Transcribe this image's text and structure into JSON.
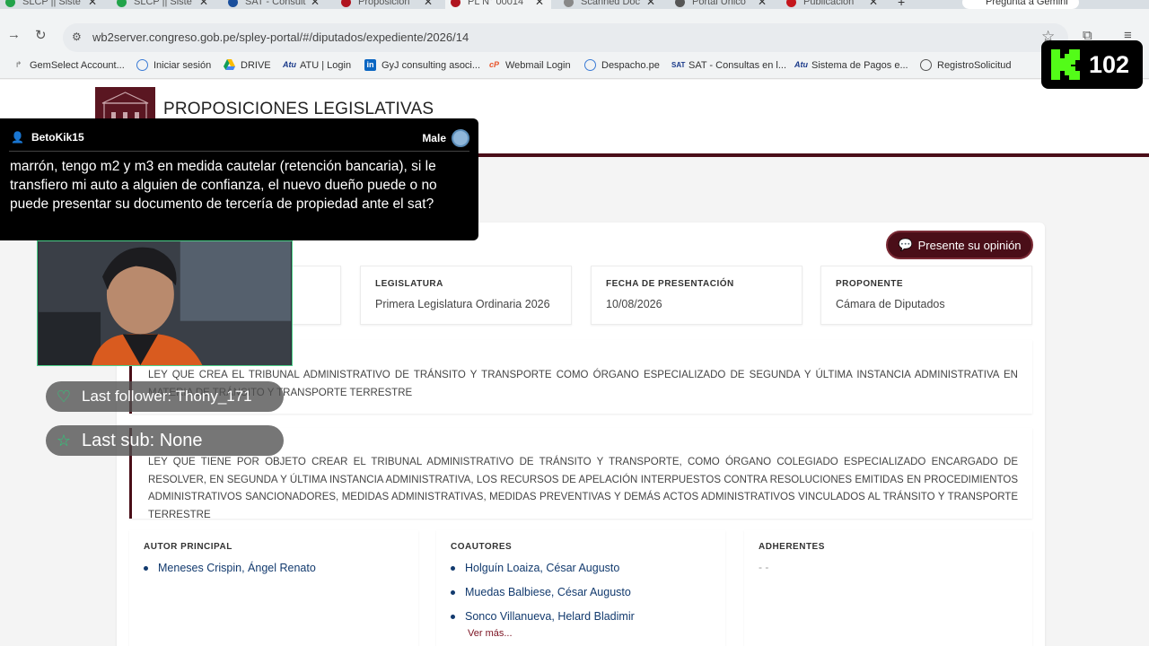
{
  "browser": {
    "tabs": [
      {
        "title": "SLCP || Siste",
        "color": "#22a34a"
      },
      {
        "title": "SLCP || Siste",
        "color": "#22a34a"
      },
      {
        "title": "SAT - Consult",
        "color": "#1a4f9c"
      },
      {
        "title": "Proposicion",
        "color": "#b0141f"
      },
      {
        "title": "PL N° 00014",
        "color": "#b0141f"
      },
      {
        "title": "Scanned Doc",
        "color": "#888888"
      },
      {
        "title": "Portal Único",
        "color": "#555555"
      },
      {
        "title": "Publicación",
        "color": "#c4161c"
      }
    ],
    "gemini_label": "Pregunta a Gemini",
    "url": "wb2server.congreso.gob.pe/spley-portal/#/diputados/expediente/2026/14",
    "bookmarks": [
      {
        "label": "GemSelect Account...",
        "icon": "gemselect-icon"
      },
      {
        "label": "Iniciar sesión",
        "icon": "globe-icon"
      },
      {
        "label": "DRIVE",
        "icon": "drive-icon"
      },
      {
        "label": "ATU | Login",
        "icon": "atu-icon"
      },
      {
        "label": "GyJ consulting asoci...",
        "icon": "linkedin-icon"
      },
      {
        "label": "Webmail Login",
        "icon": "webmail-icon"
      },
      {
        "label": "Despacho.pe",
        "icon": "globe-icon"
      },
      {
        "label": "SAT - Consultas en l...",
        "icon": "sat-icon"
      },
      {
        "label": "Sistema de Pagos e...",
        "icon": "atu-icon"
      },
      {
        "label": "RegistroSolicitud",
        "icon": "globe-icon"
      }
    ]
  },
  "page": {
    "title": "PROPOSICIONES LEGISLATIVAS",
    "opinion_button": "Presente su opinión",
    "meta": [
      {
        "label": "LEGISLATURA",
        "value": "Primera Legislatura Ordinaria 2026"
      },
      {
        "label": "FECHA DE PRESENTACIÓN",
        "value": "10/08/2026"
      },
      {
        "label": "PROPONENTE",
        "value": "Cámara de Diputados"
      }
    ],
    "titulo_text": "LEY QUE CREA EL TRIBUNAL ADMINISTRATIVO DE TRÁNSITO Y TRANSPORTE COMO ÓRGANO ESPECIALIZADO DE SEGUNDA Y ÚLTIMA INSTANCIA ADMINISTRATIVA EN MATERIA DE TRÁNSITO Y TRANSPORTE TERRESTRE",
    "sumilla_text": "LEY QUE TIENE POR OBJETO CREAR EL TRIBUNAL ADMINISTRATIVO DE TRÁNSITO Y TRANSPORTE, COMO ÓRGANO COLEGIADO ESPECIALIZADO ENCARGADO DE RESOLVER, EN SEGUNDA Y ÚLTIMA INSTANCIA ADMINISTRATIVA, LOS RECURSOS DE APELACIÓN INTERPUESTOS CONTRA RESOLUCIONES EMITIDAS EN PROCEDIMIENTOS ADMINISTRATIVOS SANCIONADORES, MEDIDAS ADMINISTRATIVAS, MEDIDAS PREVENTIVAS Y DEMÁS ACTOS ADMINISTRATIVOS VINCULADOS AL TRÁNSITO Y TRANSPORTE TERRESTRE",
    "autor_label": "AUTOR PRINCIPAL",
    "autor": "Meneses Crispin, Ángel Renato",
    "coautores_label": "COAUTORES",
    "coautores": [
      "Holguín Loaiza, César Augusto",
      "Muedas Balbiese, César Augusto",
      "Sonco Villanueva, Helard Bladimir"
    ],
    "ver_mas": "Ver más...",
    "adherentes_label": "ADHERENTES",
    "adherentes_value": "- -"
  },
  "stream": {
    "chat_user": "BetoKik15",
    "chat_gender": "Male",
    "chat_message": "marrón, tengo m2 y m3 en medida cautelar (retención bancaria), si le transfiero mi auto a alguien de confianza, el nuevo dueño puede o no puede presentar su documento de tercería de propiedad ante el sat?",
    "last_follower": "Last follower: Thony_171",
    "last_sub": "Last sub: None",
    "viewer_count": "102",
    "accent": "#53fc18"
  }
}
